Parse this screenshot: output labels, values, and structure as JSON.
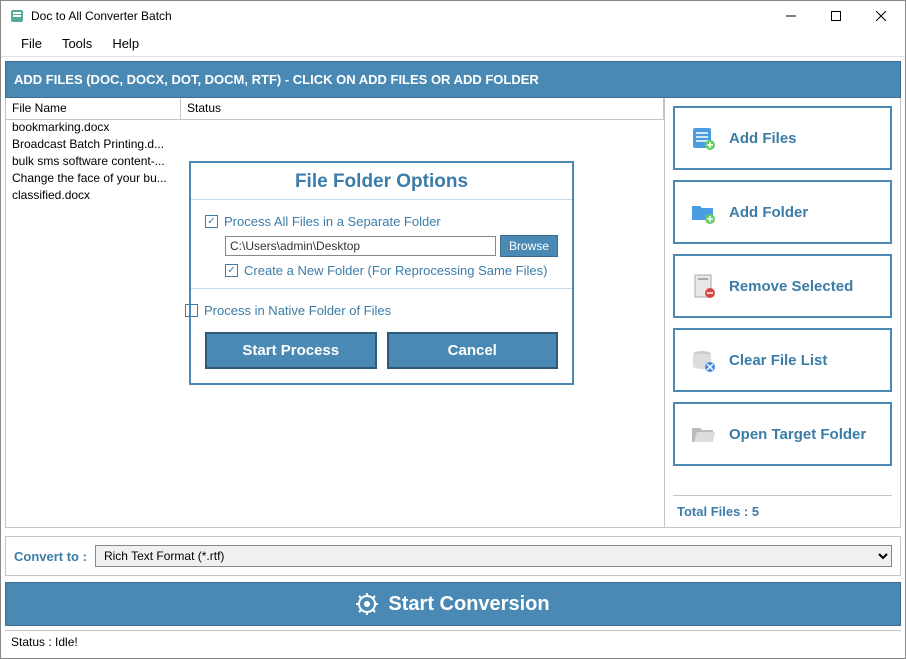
{
  "window": {
    "title": "Doc to All Converter Batch"
  },
  "menu": {
    "file": "File",
    "tools": "Tools",
    "help": "Help"
  },
  "banner": "ADD FILES (DOC, DOCX, DOT, DOCM, RTF) - CLICK ON ADD FILES OR ADD FOLDER",
  "table": {
    "header_name": "File Name",
    "header_status": "Status",
    "rows": [
      "bookmarking.docx",
      "Broadcast Batch Printing.d...",
      "bulk sms software content-...",
      "Change the face of your bu...",
      "classified.docx"
    ]
  },
  "sidebar": {
    "add_files": "Add Files",
    "add_folder": "Add Folder",
    "remove_selected": "Remove Selected",
    "clear_list": "Clear File List",
    "open_target": "Open Target Folder",
    "total_files": "Total Files : 5"
  },
  "dialog": {
    "title": "File Folder Options",
    "process_separate": "Process All Files in a Separate Folder",
    "path": "C:\\Users\\admin\\Desktop",
    "browse": "Browse",
    "create_new": "Create a New Folder (For Reprocessing Same Files)",
    "process_native": "Process in Native Folder of Files",
    "start": "Start Process",
    "cancel": "Cancel"
  },
  "convert": {
    "label": "Convert to :",
    "selected": "Rich Text Format (*.rtf)"
  },
  "start_conversion": "Start Conversion",
  "status": "Status  :  Idle!"
}
